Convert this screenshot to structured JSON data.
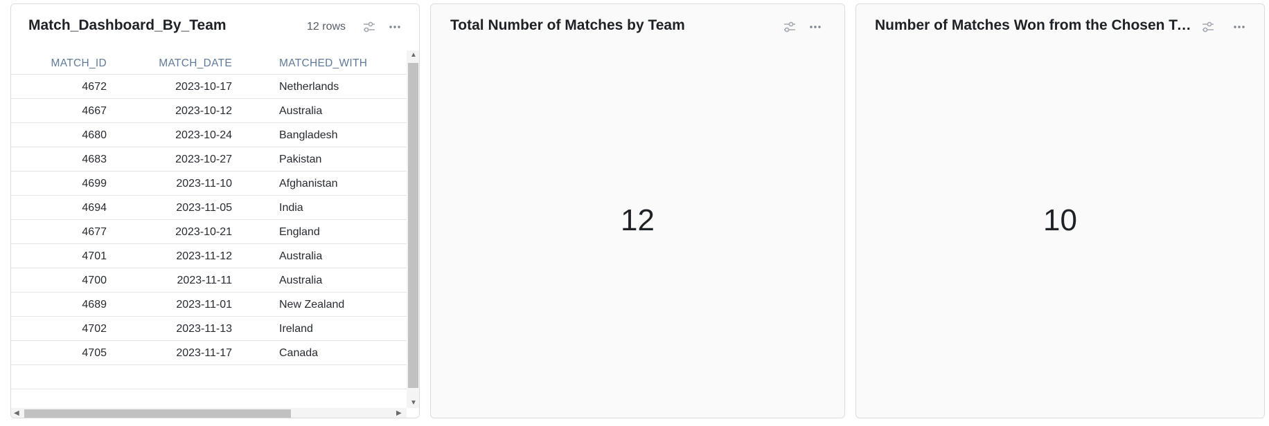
{
  "panels": [
    {
      "title": "Match_Dashboard_By_Team",
      "row_count": "12 rows",
      "icons": [
        "filter-settings-icon",
        "more-options-icon"
      ],
      "table": {
        "columns": [
          "MATCH_ID",
          "MATCH_DATE",
          "MATCHED_WITH"
        ],
        "rows": [
          [
            "4672",
            "2023-10-17",
            "Netherlands"
          ],
          [
            "4667",
            "2023-10-12",
            "Australia"
          ],
          [
            "4680",
            "2023-10-24",
            "Bangladesh"
          ],
          [
            "4683",
            "2023-10-27",
            "Pakistan"
          ],
          [
            "4699",
            "2023-11-10",
            "Afghanistan"
          ],
          [
            "4694",
            "2023-11-05",
            "India"
          ],
          [
            "4677",
            "2023-10-21",
            "England"
          ],
          [
            "4701",
            "2023-11-12",
            "Australia"
          ],
          [
            "4700",
            "2023-11-11",
            "Australia"
          ],
          [
            "4689",
            "2023-11-01",
            "New Zealand"
          ],
          [
            "4702",
            "2023-11-13",
            "Ireland"
          ],
          [
            "4705",
            "2023-11-17",
            "Canada"
          ]
        ]
      }
    },
    {
      "title": "Total Number of Matches by Team",
      "value": "12",
      "icons": [
        "filter-settings-icon",
        "more-options-icon"
      ]
    },
    {
      "title": "Number of Matches Won from the Chosen Team",
      "value": "10",
      "icons": [
        "filter-settings-icon",
        "more-options-icon"
      ]
    }
  ],
  "colors": {
    "header_text": "#5f7a9a",
    "panel_border": "#d9dce1",
    "panel_bg": "#fafafa"
  }
}
